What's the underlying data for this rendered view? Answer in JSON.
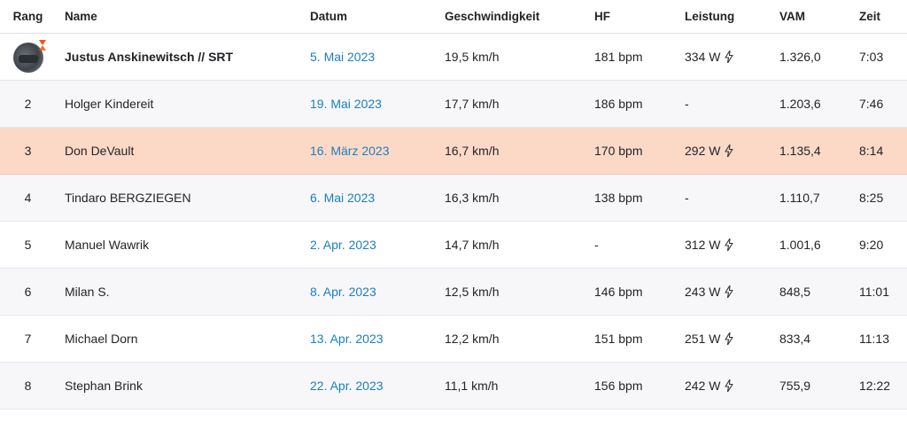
{
  "headers": {
    "rank": "Rang",
    "name": "Name",
    "date": "Datum",
    "speed": "Geschwindigkeit",
    "hr": "HF",
    "power": "Leistung",
    "vam": "VAM",
    "time": "Zeit"
  },
  "colors": {
    "accent": "#fc5200",
    "date_link": "#1a7fbf",
    "highlight_row": "#fcd9c7"
  },
  "rows": [
    {
      "rank": "",
      "name": "Justus Anskinewitsch // SRT",
      "date": "5. Mai 2023",
      "speed": "19,5 km/h",
      "hr": "181 bpm",
      "power": "334 W",
      "vam": "1.326,0",
      "time": "7:03"
    },
    {
      "rank": "2",
      "name": "Holger Kindereit",
      "date": "19. Mai 2023",
      "speed": "17,7 km/h",
      "hr": "186 bpm",
      "power": "-",
      "vam": "1.203,6",
      "time": "7:46"
    },
    {
      "rank": "3",
      "name": "Don DeVault",
      "date": "16. März 2023",
      "speed": "16,7 km/h",
      "hr": "170 bpm",
      "power": "292 W",
      "vam": "1.135,4",
      "time": "8:14"
    },
    {
      "rank": "4",
      "name": "Tindaro BERGZIEGEN",
      "date": "6. Mai 2023",
      "speed": "16,3 km/h",
      "hr": "138 bpm",
      "power": "-",
      "vam": "1.110,7",
      "time": "8:25"
    },
    {
      "rank": "5",
      "name": "Manuel Wawrik",
      "date": "2. Apr. 2023",
      "speed": "14,7 km/h",
      "hr": "-",
      "power": "312 W",
      "vam": "1.001,6",
      "time": "9:20"
    },
    {
      "rank": "6",
      "name": "Milan S.",
      "date": "8. Apr. 2023",
      "speed": "12,5 km/h",
      "hr": "146 bpm",
      "power": "243 W",
      "vam": "848,5",
      "time": "11:01"
    },
    {
      "rank": "7",
      "name": "Michael Dorn",
      "date": "13. Apr. 2023",
      "speed": "12,2 km/h",
      "hr": "151 bpm",
      "power": "251 W",
      "vam": "833,4",
      "time": "11:13"
    },
    {
      "rank": "8",
      "name": "Stephan Brink",
      "date": "22. Apr. 2023",
      "speed": "11,1 km/h",
      "hr": "156 bpm",
      "power": "242 W",
      "vam": "755,9",
      "time": "12:22"
    }
  ]
}
